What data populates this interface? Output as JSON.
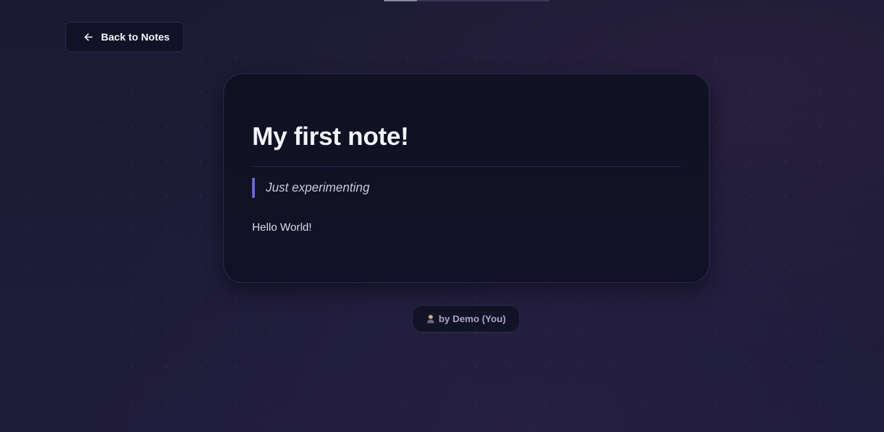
{
  "header": {
    "back_label": "Back to Notes",
    "back_icon": "arrow-left-icon",
    "loading_progress": 0.2
  },
  "note": {
    "title": "My first note!",
    "subtitle": "Just experimenting",
    "body": "Hello World!"
  },
  "author": {
    "label": "by Demo (You)",
    "icon": "user-icon"
  },
  "colors": {
    "background": "#1c1a33",
    "card": "#111124",
    "accent": "#6a67d8",
    "text": "#f3f3fa"
  }
}
